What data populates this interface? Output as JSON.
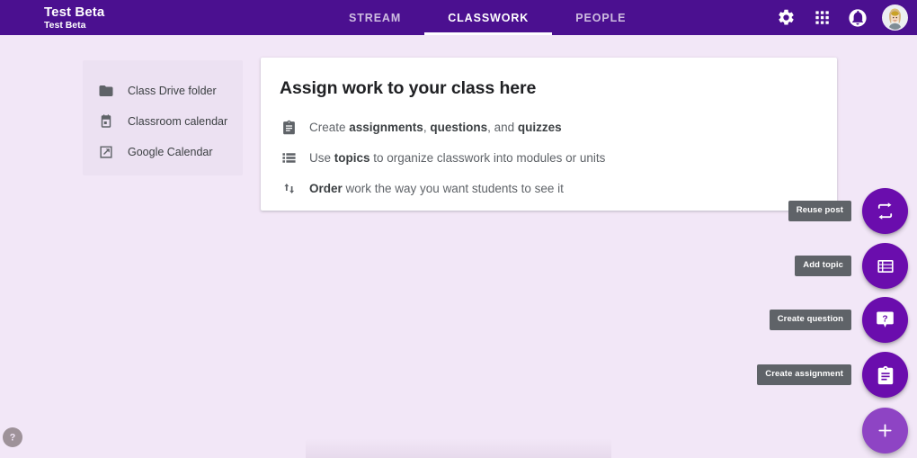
{
  "header": {
    "menu_icon": "hamburger-menu-icon",
    "class_title": "Test Beta",
    "class_subtitle": "Test Beta",
    "tabs": [
      {
        "label": "STREAM",
        "active": false
      },
      {
        "label": "CLASSWORK",
        "active": true
      },
      {
        "label": "PEOPLE",
        "active": false
      }
    ],
    "actions": [
      {
        "name": "settings-gear-icon",
        "label": "Settings"
      },
      {
        "name": "apps-grid-icon",
        "label": "Google apps"
      },
      {
        "name": "notification-bell-icon",
        "label": "Notifications"
      }
    ],
    "avatar_label": "Account",
    "background_color": "#4b1090",
    "active_tab_color": "#ffffff",
    "inactive_tab_color": "rgba(255,255,255,0.72)"
  },
  "sidebar": {
    "items": [
      {
        "icon": "folder-icon",
        "label": "Class Drive folder"
      },
      {
        "icon": "calendar-icon",
        "label": "Classroom calendar"
      },
      {
        "icon": "open-in-new-icon",
        "label": "Google Calendar"
      }
    ],
    "background_color": "#ece1f2"
  },
  "main_card": {
    "title": "Assign work to your class here",
    "hints": [
      {
        "icon": "assignment-clipboard-icon",
        "parts": [
          {
            "text": "Create ",
            "bold": false
          },
          {
            "text": "assignments",
            "bold": true
          },
          {
            "text": ", ",
            "bold": false
          },
          {
            "text": "questions",
            "bold": true
          },
          {
            "text": ", and ",
            "bold": false
          },
          {
            "text": "quizzes",
            "bold": true
          }
        ]
      },
      {
        "icon": "topic-list-icon",
        "parts": [
          {
            "text": "Use ",
            "bold": false
          },
          {
            "text": "topics",
            "bold": true
          },
          {
            "text": " to organize classwork into modules or units",
            "bold": false
          }
        ]
      },
      {
        "icon": "sort-order-icon",
        "parts": [
          {
            "text": "Order",
            "bold": true
          },
          {
            "text": " work the way you want students to see it",
            "bold": false
          }
        ]
      }
    ],
    "background_color": "#ffffff"
  },
  "fabs": [
    {
      "name": "reuse-post-fab",
      "tooltip": "Reuse post",
      "icon": "reuse-repeat-icon"
    },
    {
      "name": "add-topic-fab",
      "tooltip": "Add topic",
      "icon": "topic-list-icon"
    },
    {
      "name": "create-question-fab",
      "tooltip": "Create question",
      "icon": "question-bubble-icon"
    },
    {
      "name": "create-assignment-fab",
      "tooltip": "Create assignment",
      "icon": "assignment-clipboard-icon"
    }
  ],
  "main_fab": {
    "name": "create-fab",
    "icon": "plus-icon",
    "color": "#8e44c4"
  },
  "fab_color": "#6a0dad",
  "tooltip_color": "#5f6368",
  "help_button": {
    "icon": "help-question-icon",
    "label": "Help"
  },
  "page": {
    "background_color": "#f2e7f7"
  }
}
